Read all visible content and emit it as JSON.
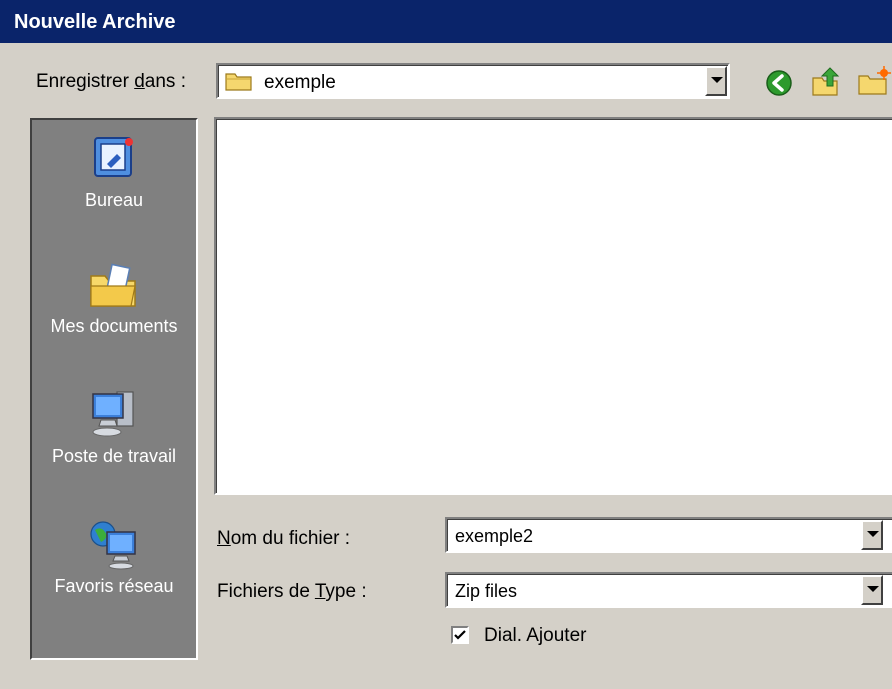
{
  "window": {
    "title": "Nouvelle Archive"
  },
  "save_in": {
    "label_before": "Enregistrer ",
    "label_access": "d",
    "label_after": "ans :",
    "value": "exemple"
  },
  "toolbar": {
    "back_icon": "green-back-arrow-icon",
    "up_icon": "folder-up-icon",
    "new_folder_icon": "new-folder-icon"
  },
  "places": [
    {
      "label": "Bureau",
      "icon": "desktop-icon"
    },
    {
      "label": "Mes documents",
      "icon": "my-documents-icon"
    },
    {
      "label": "Poste de travail",
      "icon": "my-computer-icon"
    },
    {
      "label": "Favoris réseau",
      "icon": "network-places-icon"
    }
  ],
  "filename": {
    "label_access": "N",
    "label_after": "om du fichier :",
    "value": "exemple2"
  },
  "filetype": {
    "label_before": "Fichiers de ",
    "label_access": "T",
    "label_after": "ype :",
    "value": "Zip files"
  },
  "add_dialog": {
    "checked": true,
    "label_before": "Dial. A",
    "label_access": "j",
    "label_after": "outer"
  },
  "colors": {
    "title_bar": "#0a246a",
    "dialog_bg": "#d4d0c8",
    "places_bg": "#808080"
  }
}
